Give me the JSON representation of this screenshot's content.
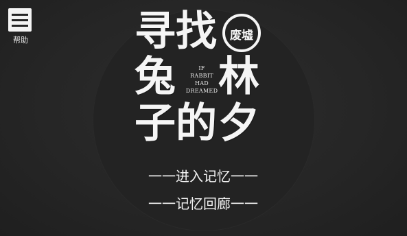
{
  "help": {
    "label": "帮助",
    "icon": "menu-icon"
  },
  "title": {
    "chars": [
      "寻",
      "找",
      "兔",
      "林",
      "子",
      "的",
      "夕"
    ],
    "stamp": "废墟"
  },
  "subtitle": {
    "lines": [
      "IF",
      "RABBIT",
      "HAD",
      "DREAMED"
    ]
  },
  "menu": {
    "enter_memory": "一一进入记忆一一",
    "memory_gallery": "一一记忆回廊一一"
  },
  "colors": {
    "background": "#262626",
    "text": "#f5f5f5"
  }
}
